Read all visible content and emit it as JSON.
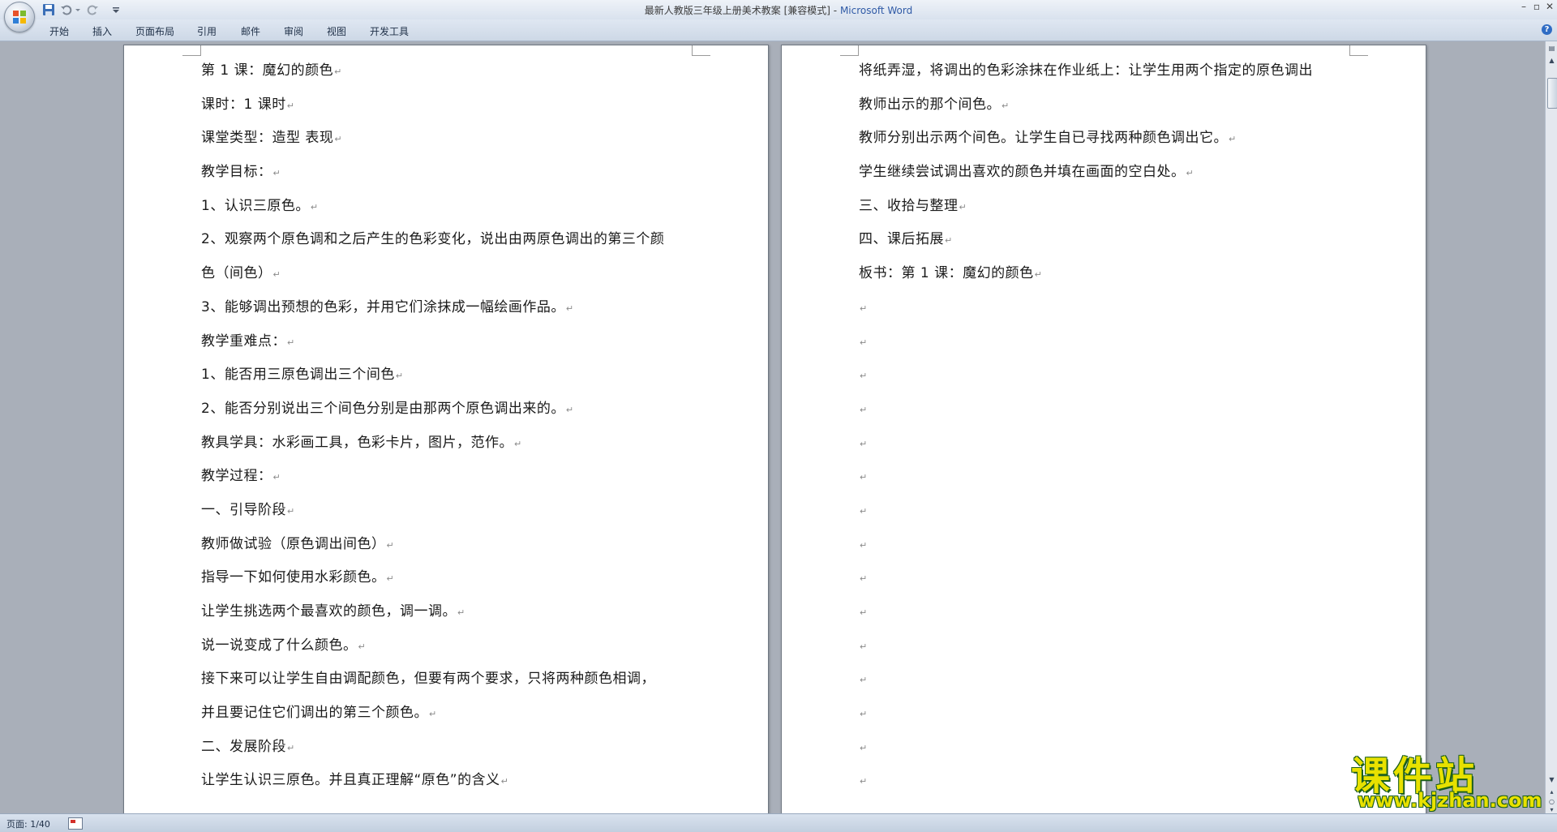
{
  "window": {
    "title_doc": "最新人教版三年级上册美术教案 [兼容模式]",
    "title_sep": " - ",
    "title_app": "Microsoft Word"
  },
  "quick_access": {
    "icons": [
      "save-icon",
      "undo-icon",
      "redo-icon",
      "customize-dropdown-icon"
    ]
  },
  "ribbon": {
    "tabs": [
      "开始",
      "插入",
      "页面布局",
      "引用",
      "邮件",
      "审阅",
      "视图",
      "开发工具"
    ],
    "help_label": "?"
  },
  "document": {
    "left_page_lines": [
      "第 1 课：魔幻的颜色",
      "课时：1 课时",
      "课堂类型：造型 表现",
      "教学目标：",
      "1、认识三原色。",
      "2、观察两个原色调和之后产生的色彩变化，说出由两原色调出的第三个颜",
      "色（间色）",
      "3、能够调出预想的色彩，并用它们涂抹成一幅绘画作品。",
      "教学重难点：",
      "1、能否用三原色调出三个间色",
      "2、能否分别说出三个间色分别是由那两个原色调出来的。",
      "教具学具：水彩画工具，色彩卡片，图片，范作。",
      "教学过程：",
      "一、引导阶段",
      "教师做试验（原色调出间色）",
      "指导一下如何使用水彩颜色。",
      "让学生挑选两个最喜欢的颜色，调一调。",
      "说一说变成了什么颜色。",
      "接下来可以让学生自由调配颜色，但要有两个要求，只将两种颜色相调，",
      "并且要记住它们调出的第三个颜色。",
      "二、发展阶段",
      "让学生认识三原色。并且真正理解“原色”的含义"
    ],
    "left_page_marks": [
      true,
      true,
      true,
      true,
      true,
      false,
      true,
      true,
      true,
      true,
      true,
      true,
      true,
      true,
      true,
      true,
      true,
      true,
      false,
      true,
      true,
      true
    ],
    "right_page_lines": [
      "将纸弄湿，将调出的色彩涂抹在作业纸上：让学生用两个指定的原色调出",
      "教师出示的那个间色。",
      "教师分别出示两个间色。让学生自已寻找两种颜色调出它。",
      "学生继续尝试调出喜欢的颜色并填在画面的空白处。",
      "三、收拾与整理",
      "四、课后拓展",
      "板书：第 1 课：魔幻的颜色",
      "",
      "",
      "",
      "",
      "",
      "",
      "",
      "",
      "",
      "",
      "",
      "",
      "",
      "",
      ""
    ],
    "right_page_marks": [
      false,
      true,
      true,
      true,
      true,
      true,
      true,
      true,
      true,
      true,
      true,
      true,
      true,
      true,
      true,
      true,
      true,
      true,
      true,
      true,
      true,
      true
    ],
    "paragraph_mark": "↵"
  },
  "statusbar": {
    "page_info": "页面: 1/40"
  },
  "watermark": {
    "title": "课件站",
    "url": "www.kjzhan.com"
  },
  "colors": {
    "accent": "#2f5aa6",
    "watermark": "#e8e100"
  }
}
